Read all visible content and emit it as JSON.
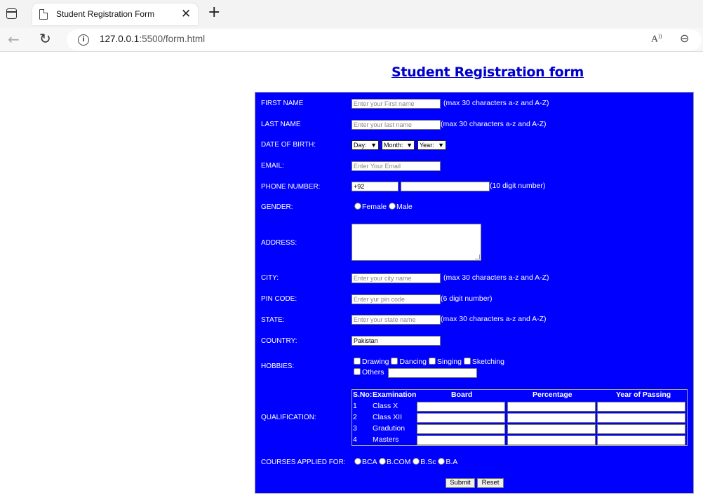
{
  "browser": {
    "tab_title": "Student Registration Form",
    "url_host": "127.0.0.1",
    "url_path": ":5500/form.html"
  },
  "page": {
    "title": "Student Registration form"
  },
  "form": {
    "first_name": {
      "label": "FIRST NAME",
      "placeholder": "Enter your First name",
      "note": "(max 30 characters a-z and A-Z)"
    },
    "last_name": {
      "label": "LAST NAME",
      "placeholder": "Enter your last name",
      "note": "(max 30 characters a-z and A-Z)"
    },
    "dob": {
      "label": "DATE OF BIRTH:",
      "day": "Day:",
      "month": "Month:",
      "year": "Year:"
    },
    "email": {
      "label": "EMAIL:",
      "placeholder": "Enter Your Email"
    },
    "phone": {
      "label": "PHONE NUMBER:",
      "code": "+92",
      "note": "(10 digit number)"
    },
    "gender": {
      "label": "GENDER:",
      "options": [
        "Female",
        "Male"
      ]
    },
    "address": {
      "label": "ADDRESS:"
    },
    "city": {
      "label": "CITY:",
      "placeholder": "Enter your city name",
      "note": "(max 30 characters a-z and A-Z)"
    },
    "pin": {
      "label": "PIN CODE:",
      "placeholder": "Enter yur pin code",
      "note": "(6 digit number)"
    },
    "state": {
      "label": "STATE:",
      "placeholder": "Enter your state name",
      "note": "(max 30 characters a-z and A-Z)"
    },
    "country": {
      "label": "COUNTRY:",
      "value": "Pakistan"
    },
    "hobbies": {
      "label": "HOBBIES:",
      "options": [
        "Drawing",
        "Dancing",
        "Singing",
        "Sketching"
      ],
      "other": "Others"
    },
    "qualification": {
      "label": "QUALIFICATION:",
      "headers": [
        "S.No:",
        "Examination",
        "Board",
        "Percentage",
        "Year of Passing"
      ],
      "rows": [
        {
          "sno": "1",
          "exam": "Class X"
        },
        {
          "sno": "2",
          "exam": "Class XII"
        },
        {
          "sno": "3",
          "exam": "Gradution"
        },
        {
          "sno": "4",
          "exam": "Masters"
        }
      ]
    },
    "courses": {
      "label": "COURSES APPLIED FOR:",
      "options": [
        "BCA",
        "B.COM",
        "B.Sc",
        "B.A"
      ]
    },
    "buttons": {
      "submit": "Submit",
      "reset": "Reset"
    }
  }
}
